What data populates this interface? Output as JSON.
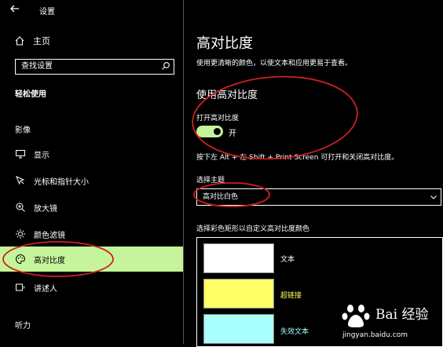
{
  "window": {
    "title": "设置"
  },
  "sidebar": {
    "home_label": "主页",
    "search_placeholder": "查找设置",
    "category": "轻松使用",
    "group_vision": "影像",
    "items": [
      {
        "label": "显示",
        "icon": "monitor-icon"
      },
      {
        "label": "光标和指针大小",
        "icon": "cursor-icon"
      },
      {
        "label": "放大镜",
        "icon": "magnifier-icon"
      },
      {
        "label": "颜色滤镜",
        "icon": "brightness-icon"
      },
      {
        "label": "高对比度",
        "icon": "palette-icon",
        "selected": true
      },
      {
        "label": "讲述人",
        "icon": "narrator-icon"
      }
    ],
    "group_hearing": "听力"
  },
  "main": {
    "title": "高对比度",
    "description": "使用更清晰的颜色，以使文本和应用更易于查看。",
    "section_title": "使用高对比度",
    "toggle_label": "打开高对比度",
    "toggle_state": "开",
    "toggle_on": true,
    "shortcut_hint": "按下左 Alt + 左 Shift + Print Screen 可打开和关闭高对比度。",
    "theme_label": "选择主题",
    "theme_value": "高对比白色",
    "colors_label": "选择彩色矩形以自定义高对比度颜色",
    "swatches": [
      {
        "label": "文本",
        "color": "#ffffff",
        "label_color": "#ffffff"
      },
      {
        "label": "超链接",
        "color": "#ffff66",
        "label_color": "#ffff66"
      },
      {
        "label": "失效文本",
        "color": "#aaffff",
        "label_color": "#aaffff"
      }
    ]
  },
  "colors": {
    "accent": "#c5f49a",
    "annotation": "#cc2020"
  },
  "watermark": {
    "brand": "Bai 经验",
    "url": "jingyan.baidu.com"
  }
}
